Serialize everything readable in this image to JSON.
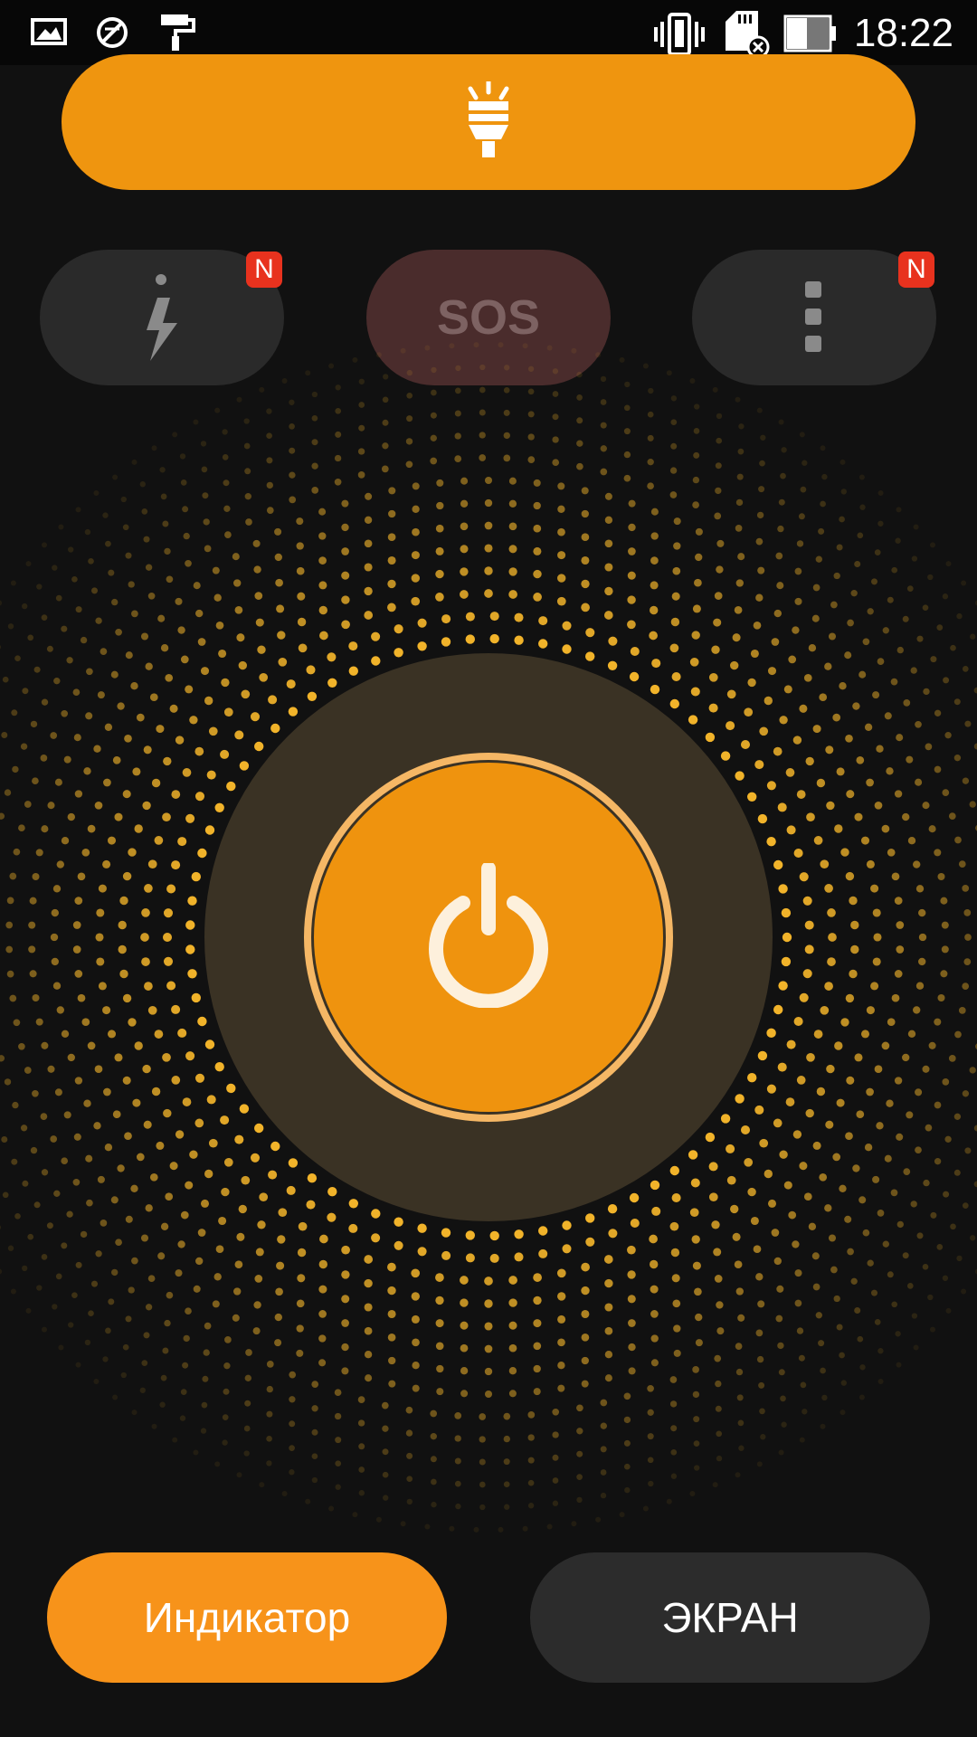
{
  "status_bar": {
    "time": "18:22",
    "icons": [
      "gallery-icon",
      "no-sim-icon",
      "paint-roller-icon",
      "vibrate-icon",
      "sd-card-error-icon",
      "battery-icon"
    ]
  },
  "top_bar": {
    "icon": "flashlight-icon"
  },
  "modes": {
    "strobe": {
      "icon": "lightning-icon",
      "badge": "N"
    },
    "sos": {
      "label": "SOS"
    },
    "more": {
      "icon": "more-vertical-icon",
      "badge": "N"
    }
  },
  "power": {
    "icon": "power-icon"
  },
  "bottom_buttons": {
    "indicator_label": "Индикатор",
    "screen_label": "ЭКРАН"
  },
  "colors": {
    "accent": "#ef950f",
    "background": "#111111",
    "sos_background": "#4a2c2c",
    "badge": "#e8321e"
  }
}
